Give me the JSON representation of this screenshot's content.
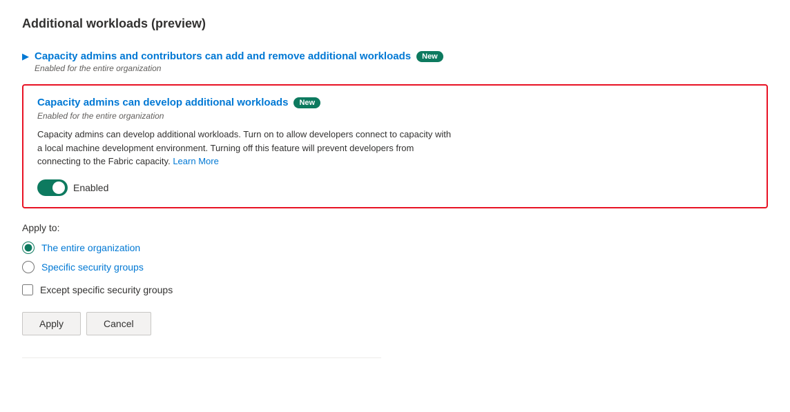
{
  "page": {
    "title": "Additional workloads (preview)"
  },
  "collapsed_item": {
    "title": "Capacity admins and contributors can add and remove additional workloads",
    "badge": "New",
    "subtitle": "Enabled for the entire organization"
  },
  "expanded_item": {
    "title": "Capacity admins can develop additional workloads",
    "badge": "New",
    "subtitle": "Enabled for the entire organization",
    "description": "Capacity admins can develop additional workloads. Turn on to allow developers connect to capacity with a local machine development environment. Turning off this feature will prevent developers from connecting to the Fabric capacity.",
    "learn_more": "Learn More",
    "toggle_label": "Enabled"
  },
  "apply_to": {
    "title": "Apply to:",
    "options": [
      {
        "label": "The entire organization",
        "value": "entire",
        "checked": true
      },
      {
        "label": "Specific security groups",
        "value": "specific",
        "checked": false
      }
    ],
    "except_label": "Except specific security groups"
  },
  "buttons": {
    "apply": "Apply",
    "cancel": "Cancel"
  },
  "badges": {
    "new_1": "New",
    "new_2": "New"
  }
}
